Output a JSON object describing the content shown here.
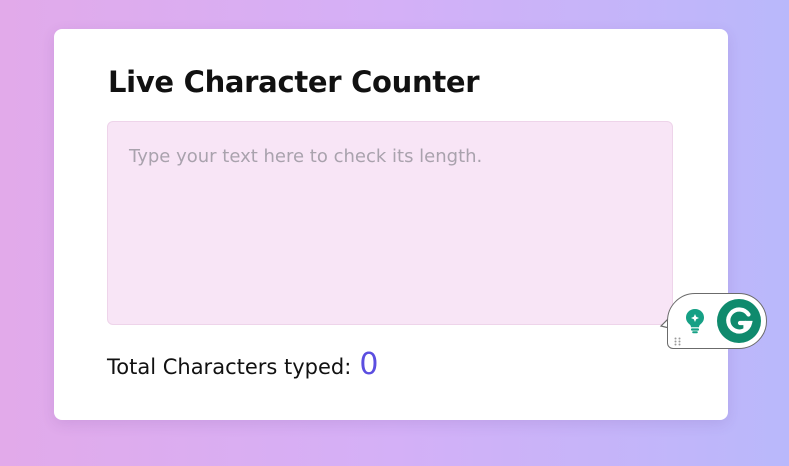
{
  "page": {
    "title": "Live Character Counter"
  },
  "editor": {
    "placeholder": "Type your text here to check its length.",
    "value": ""
  },
  "counter": {
    "label": "Total Characters typed:",
    "value": "0"
  },
  "grammarly": {
    "icons": [
      "drag-handle-icon",
      "lightbulb-icon",
      "grammarly-logo-icon"
    ],
    "brand_color": "#0f8a6d"
  },
  "colors": {
    "background_gradient": [
      "#e2aaea",
      "#d4b0f7",
      "#b9b8fb"
    ],
    "card": "#ffffff",
    "textarea_bg": "#f8e5f6",
    "counter_value": "#5b4ee0"
  }
}
